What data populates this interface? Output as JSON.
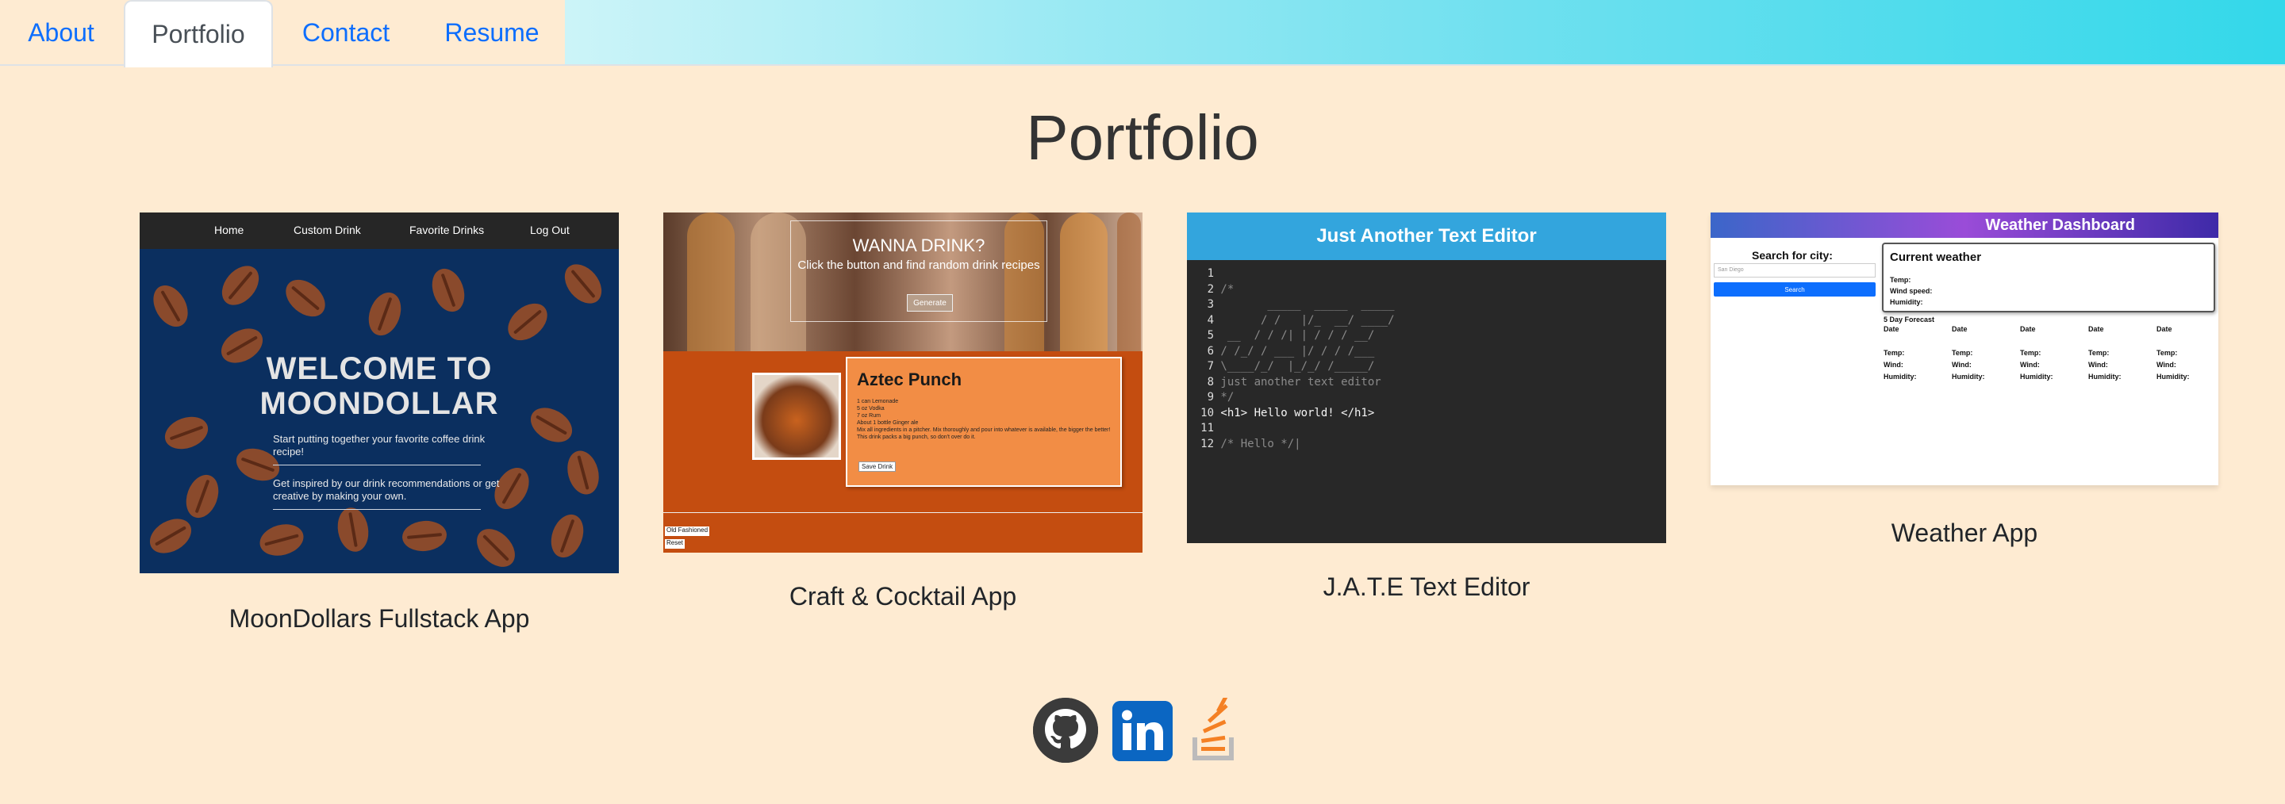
{
  "nav": {
    "tabs": [
      {
        "label": "About"
      },
      {
        "label": "Portfolio"
      },
      {
        "label": "Contact"
      },
      {
        "label": "Resume"
      }
    ],
    "active_tab": "Portfolio"
  },
  "page_title": "Portfolio",
  "projects": {
    "moondollars": {
      "caption": "MoonDollars Fullstack App",
      "nav": [
        "Home",
        "Custom Drink",
        "Favorite Drinks",
        "Log Out"
      ],
      "title_line1": "WELCOME TO",
      "title_line2": "MOONDOLLAR",
      "sub1": "Start putting together your favorite coffee drink recipe!",
      "sub2": "Get inspired by our drink recommendations or get creative by making your own."
    },
    "cocktail": {
      "caption": "Craft & Cocktail App",
      "hero_title": "WANNA DRINK?",
      "hero_sub": "Click the button and find random drink recipes",
      "hero_button": "Generate",
      "drink_name": "Aztec Punch",
      "ingredients": "1 can Lemonade\n5 oz Vodka\n7 oz Rum\nAbout 1 bottle Ginger ale\nMix all ingredients in a pitcher. Mix thoroughly and pour into whatever is available, the bigger the better! This drink packs a big punch, so don't over do it.",
      "save_button": "Save Drink",
      "footer_mini1": "Old Fashioned",
      "footer_mini2": "Reset"
    },
    "jate": {
      "caption": "J.A.T.E Text Editor",
      "header": "Just Another Text Editor",
      "lines": [
        {
          "n": "1",
          "text": "",
          "kind": "code"
        },
        {
          "n": "2",
          "text": "/*",
          "kind": "comment"
        },
        {
          "n": "3",
          "text": "       _____  _____  _____",
          "kind": "comment"
        },
        {
          "n": "4",
          "text": "      / /   |/_  __/ ____/",
          "kind": "comment"
        },
        {
          "n": "5",
          "text": " __  / / /| | / / / __/",
          "kind": "comment"
        },
        {
          "n": "6",
          "text": "/ /_/ / ___ |/ / / /___",
          "kind": "comment"
        },
        {
          "n": "7",
          "text": "\\____/_/  |_/_/ /_____/",
          "kind": "comment"
        },
        {
          "n": "8",
          "text": "just another text editor",
          "kind": "comment"
        },
        {
          "n": "9",
          "text": "*/",
          "kind": "comment"
        },
        {
          "n": "10",
          "text": "<h1> Hello world! </h1>",
          "kind": "code"
        },
        {
          "n": "11",
          "text": "",
          "kind": "code"
        },
        {
          "n": "12",
          "text": "/* Hello */|",
          "kind": "comment"
        }
      ]
    },
    "weather": {
      "caption": "Weather App",
      "header": "Weather Dashboard",
      "search_label": "Search for city:",
      "search_placeholder": "San Diego",
      "search_button": "Search",
      "current_title": "Current weather",
      "temp": "Temp:",
      "wind": "Wind speed:",
      "humidity": "Humidity:",
      "forecast_title": "5 Day Forecast",
      "date": "Date",
      "f_temp": "Temp:",
      "f_wind": "Wind:",
      "f_humidity": "Humidity:"
    }
  },
  "social": [
    {
      "icon": "github-icon"
    },
    {
      "icon": "linkedin-icon"
    },
    {
      "icon": "stackoverflow-icon"
    }
  ]
}
